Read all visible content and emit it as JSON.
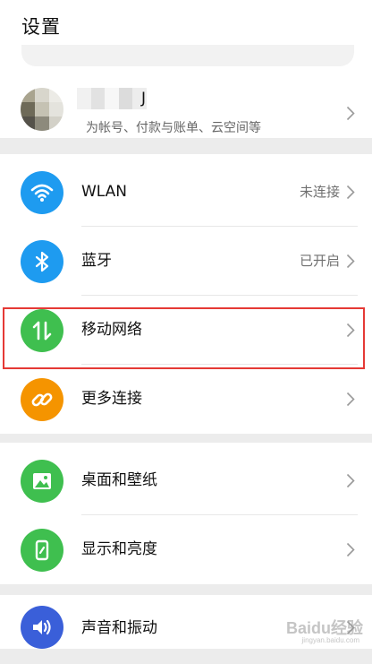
{
  "header": {
    "title": "设置"
  },
  "account": {
    "name_visible_tail": "J",
    "subtitle": "为帐号、付款与账单、云空间等"
  },
  "connectivity": {
    "items": [
      {
        "label": "WLAN",
        "value": "未连接",
        "icon": "wifi-icon",
        "color": "#1e9bf0"
      },
      {
        "label": "蓝牙",
        "value": "已开启",
        "icon": "bluetooth-icon",
        "color": "#1e9bf0"
      },
      {
        "label": "移动网络",
        "value": "",
        "icon": "mobile-data-icon",
        "color": "#3fbf4f"
      },
      {
        "label": "更多连接",
        "value": "",
        "icon": "link-icon",
        "color": "#f59400"
      }
    ]
  },
  "display": {
    "items": [
      {
        "label": "桌面和壁纸",
        "icon": "wallpaper-icon",
        "color": "#3fbf4f"
      },
      {
        "label": "显示和亮度",
        "icon": "display-icon",
        "color": "#3fbf4f"
      }
    ]
  },
  "sound": {
    "items": [
      {
        "label": "声音和振动",
        "icon": "speaker-icon",
        "color": "#3a5fd9"
      }
    ]
  },
  "highlight_color": "#e53935",
  "watermark": {
    "text": "Baidu经验",
    "sub": "jingyan.baidu.com"
  }
}
